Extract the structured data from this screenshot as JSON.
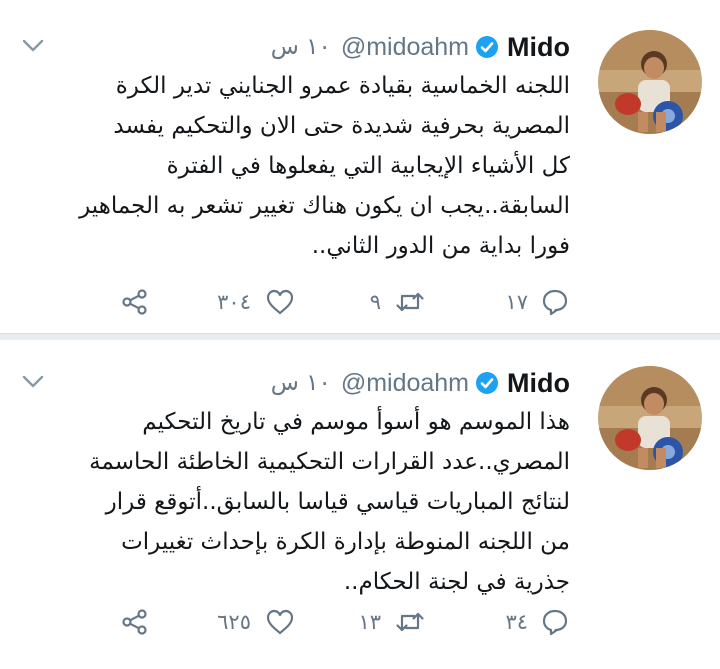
{
  "colors": {
    "accent": "#1da1f2",
    "secondary_text": "#657786",
    "text": "#14171a",
    "divider": "#e6ecf0"
  },
  "tweets": [
    {
      "name": "Mido",
      "handle": "@midoahm",
      "time": "١٠ س",
      "lines": [
        "اللجنه الخماسية بقيادة عمرو الجنايني تدير الكرة",
        "المصرية بحرفية شديدة حتى الان والتحكيم يفسد",
        "كل الأشياء الإيجابية التي يفعلوها في الفترة",
        "السابقة..يجب ان يكون هناك تغيير تشعر به الجماهير",
        "فورا بداية من الدور الثاني.."
      ],
      "replies": "١٧",
      "retweets": "٩",
      "likes": "٣٠٤"
    },
    {
      "name": "Mido",
      "handle": "@midoahm",
      "time": "١٠ س",
      "lines": [
        "هذا الموسم هو أسوأ موسم في تاريخ التحكيم",
        "المصري..عدد القرارات التحكيمية الخاطئة الحاسمة",
        "لنتائج المباريات قياسي قياسا بالسابق..أتوقع قرار",
        "من اللجنه المنوطة بإدارة الكرة بإحداث تغييرات",
        "جذرية في لجنة الحكام.."
      ],
      "replies": "٣٤",
      "retweets": "١٣",
      "likes": "٦٢٥"
    }
  ]
}
